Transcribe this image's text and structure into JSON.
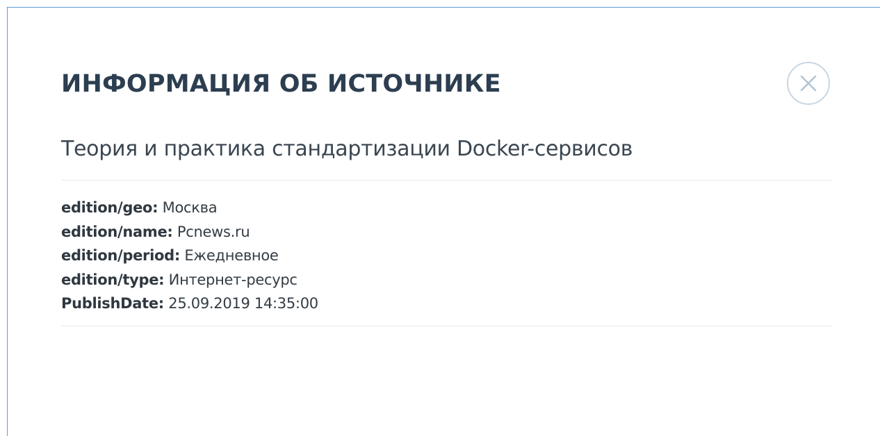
{
  "modal": {
    "title": "ИНФОРМАЦИЯ ОБ ИСТОЧНИКЕ",
    "close_icon": "close-circle-icon",
    "source_title": "Теория и практика стандартизации Docker-сервисов",
    "meta": [
      {
        "key": "edition/geo:",
        "value": "Москва"
      },
      {
        "key": "edition/name:",
        "value": "Pcnews.ru"
      },
      {
        "key": "edition/period:",
        "value": "Ежедневное"
      },
      {
        "key": "edition/type:",
        "value": "Интернет-ресурс"
      },
      {
        "key": "PublishDate:",
        "value": "25.09.2019 14:35:00"
      }
    ]
  },
  "colors": {
    "frame_border": "#5b9bd5",
    "title": "#2c3e50",
    "close_ring": "#c8d6e2",
    "divider": "#e3e8ec"
  }
}
